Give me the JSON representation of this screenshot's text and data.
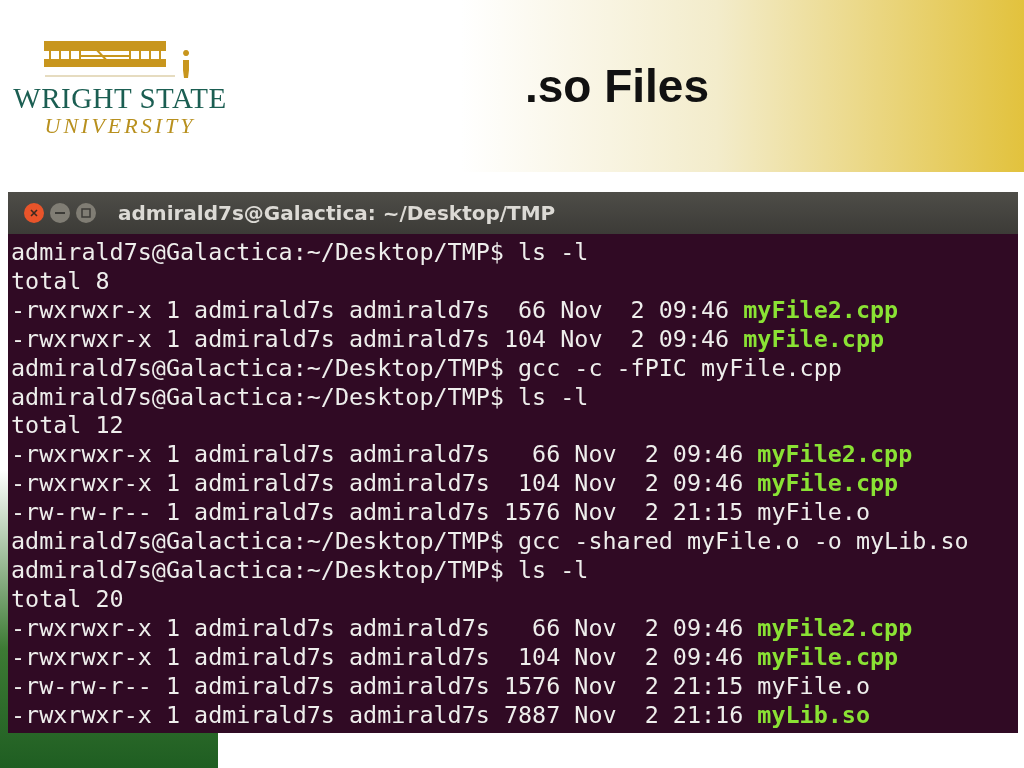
{
  "logo": {
    "name": "WRIGHT STATE",
    "subtitle": "UNIVERSITY"
  },
  "slide_title": ".so Files",
  "terminal": {
    "title": "admirald7s@Galactica: ~/Desktop/TMP",
    "lines": [
      {
        "kind": "prompt",
        "text": "admirald7s@Galactica:~/Desktop/TMP$ ls -l"
      },
      {
        "kind": "plain",
        "text": "total 8"
      },
      {
        "kind": "entry",
        "text": "-rwxrwxr-x 1 admirald7s admirald7s  66 Nov  2 09:46",
        "name": "myFile2.cpp",
        "executable": true
      },
      {
        "kind": "entry",
        "text": "-rwxrwxr-x 1 admirald7s admirald7s 104 Nov  2 09:46",
        "name": "myFile.cpp",
        "executable": true
      },
      {
        "kind": "prompt",
        "text": "admirald7s@Galactica:~/Desktop/TMP$ gcc -c -fPIC myFile.cpp"
      },
      {
        "kind": "prompt",
        "text": "admirald7s@Galactica:~/Desktop/TMP$ ls -l"
      },
      {
        "kind": "plain",
        "text": "total 12"
      },
      {
        "kind": "entry",
        "text": "-rwxrwxr-x 1 admirald7s admirald7s   66 Nov  2 09:46",
        "name": "myFile2.cpp",
        "executable": true
      },
      {
        "kind": "entry",
        "text": "-rwxrwxr-x 1 admirald7s admirald7s  104 Nov  2 09:46",
        "name": "myFile.cpp",
        "executable": true
      },
      {
        "kind": "entry",
        "text": "-rw-rw-r-- 1 admirald7s admirald7s 1576 Nov  2 21:15",
        "name": "myFile.o",
        "executable": false
      },
      {
        "kind": "prompt",
        "text": "admirald7s@Galactica:~/Desktop/TMP$ gcc -shared myFile.o -o myLib.so"
      },
      {
        "kind": "prompt",
        "text": "admirald7s@Galactica:~/Desktop/TMP$ ls -l"
      },
      {
        "kind": "plain",
        "text": "total 20"
      },
      {
        "kind": "entry",
        "text": "-rwxrwxr-x 1 admirald7s admirald7s   66 Nov  2 09:46",
        "name": "myFile2.cpp",
        "executable": true
      },
      {
        "kind": "entry",
        "text": "-rwxrwxr-x 1 admirald7s admirald7s  104 Nov  2 09:46",
        "name": "myFile.cpp",
        "executable": true
      },
      {
        "kind": "entry",
        "text": "-rw-rw-r-- 1 admirald7s admirald7s 1576 Nov  2 21:15",
        "name": "myFile.o",
        "executable": false
      },
      {
        "kind": "entry",
        "text": "-rwxrwxr-x 1 admirald7s admirald7s 7887 Nov  2 21:16",
        "name": "myLib.so",
        "executable": true
      }
    ]
  }
}
